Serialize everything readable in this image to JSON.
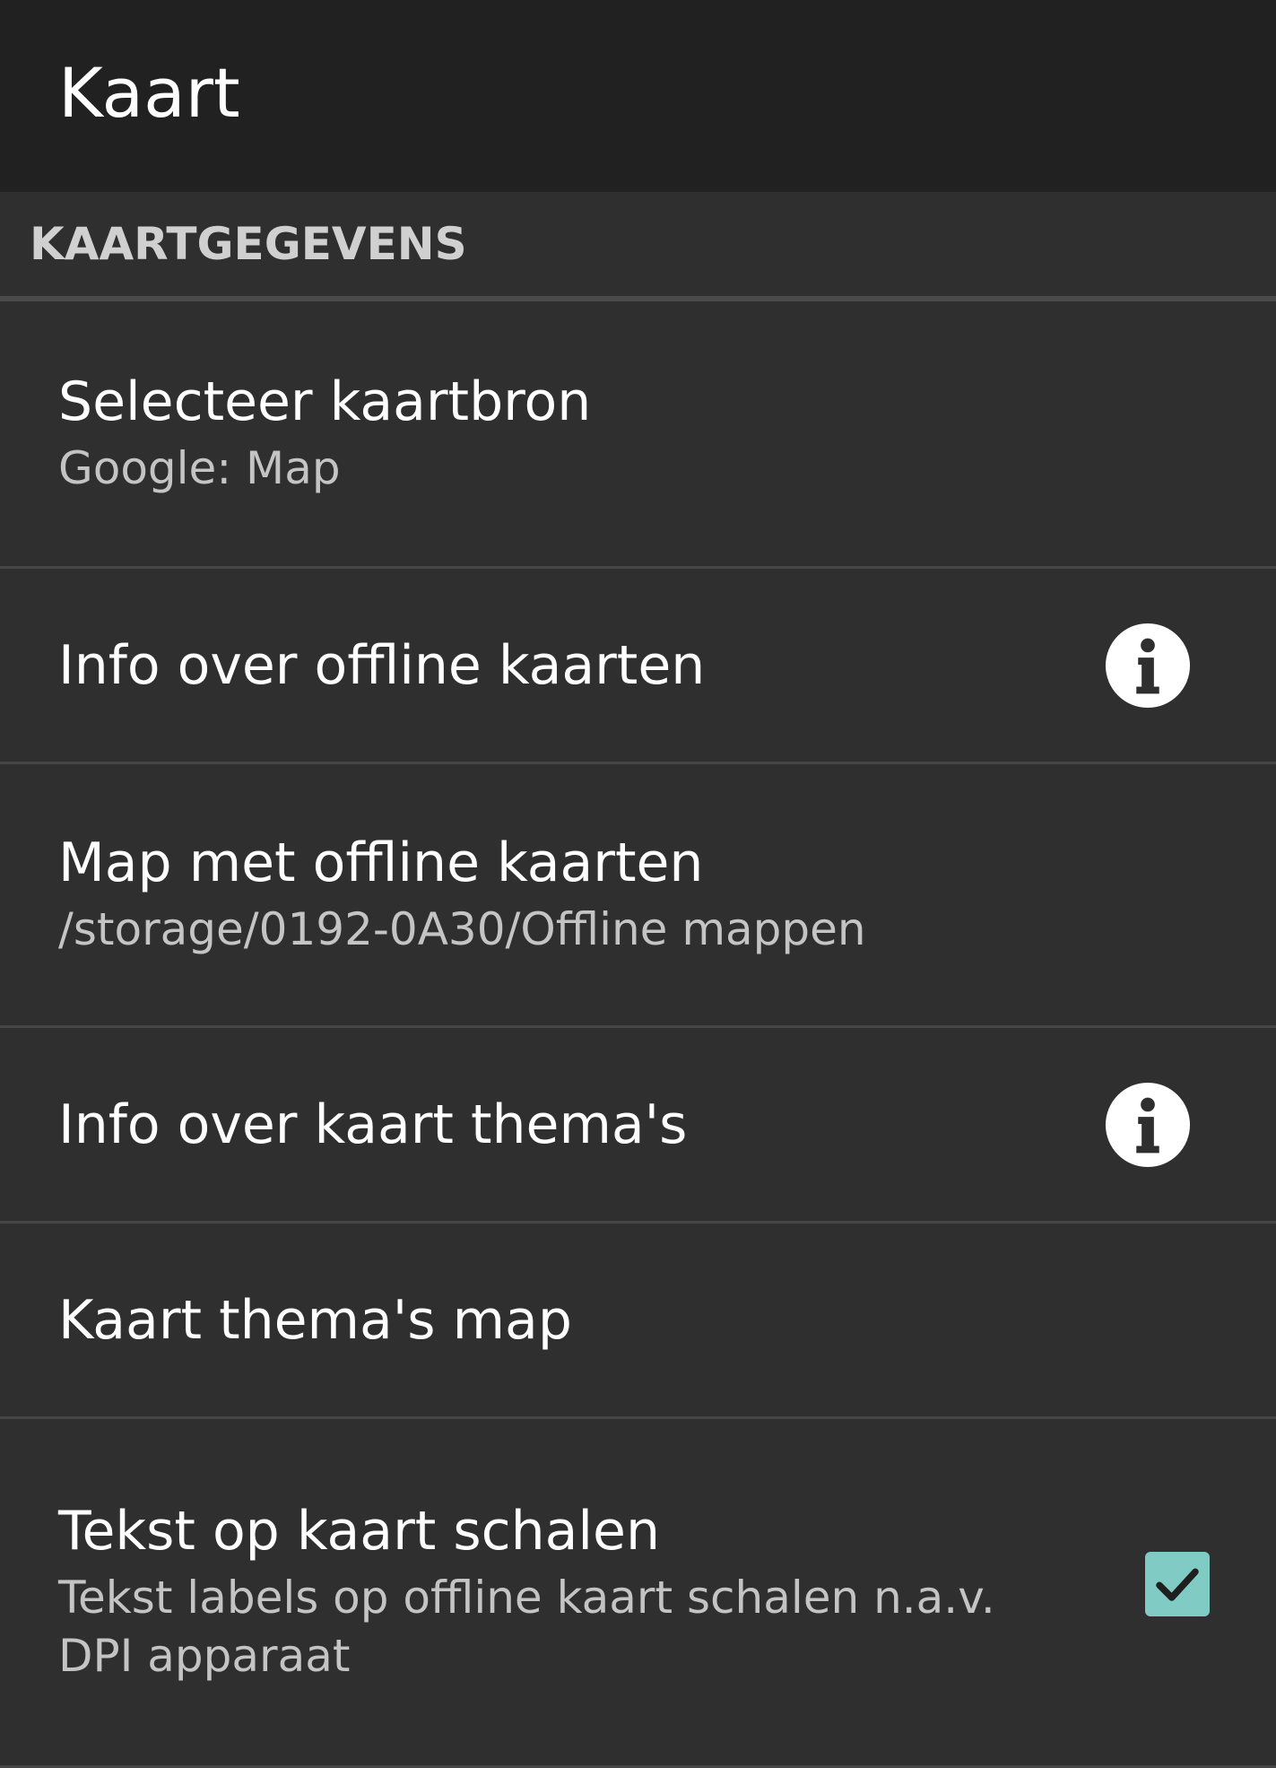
{
  "app_bar": {
    "title": "Kaart"
  },
  "section": {
    "title": "KAARTGEGEVENS"
  },
  "preferences": [
    {
      "title": "Selecteer kaartbron",
      "summary": "Google: Map"
    },
    {
      "title": "Info over offline kaarten",
      "icon": "info-icon"
    },
    {
      "title": "Map met offline kaarten",
      "summary": "/storage/0192-0A30/Offline mappen"
    },
    {
      "title": "Info over kaart thema's",
      "icon": "info-icon"
    },
    {
      "title": "Kaart thema's map"
    },
    {
      "title": "Tekst op kaart schalen",
      "summary": "Tekst labels op offline kaart schalen n.a.v. DPI apparaat",
      "checked": true
    }
  ],
  "colors": {
    "app_bar_bg": "#212121",
    "background": "#2f2f2f",
    "divider": "#464646",
    "section_text": "#d0d0d0",
    "summary_text": "#c4c4c4",
    "checkbox_accent": "#80cbc4"
  }
}
